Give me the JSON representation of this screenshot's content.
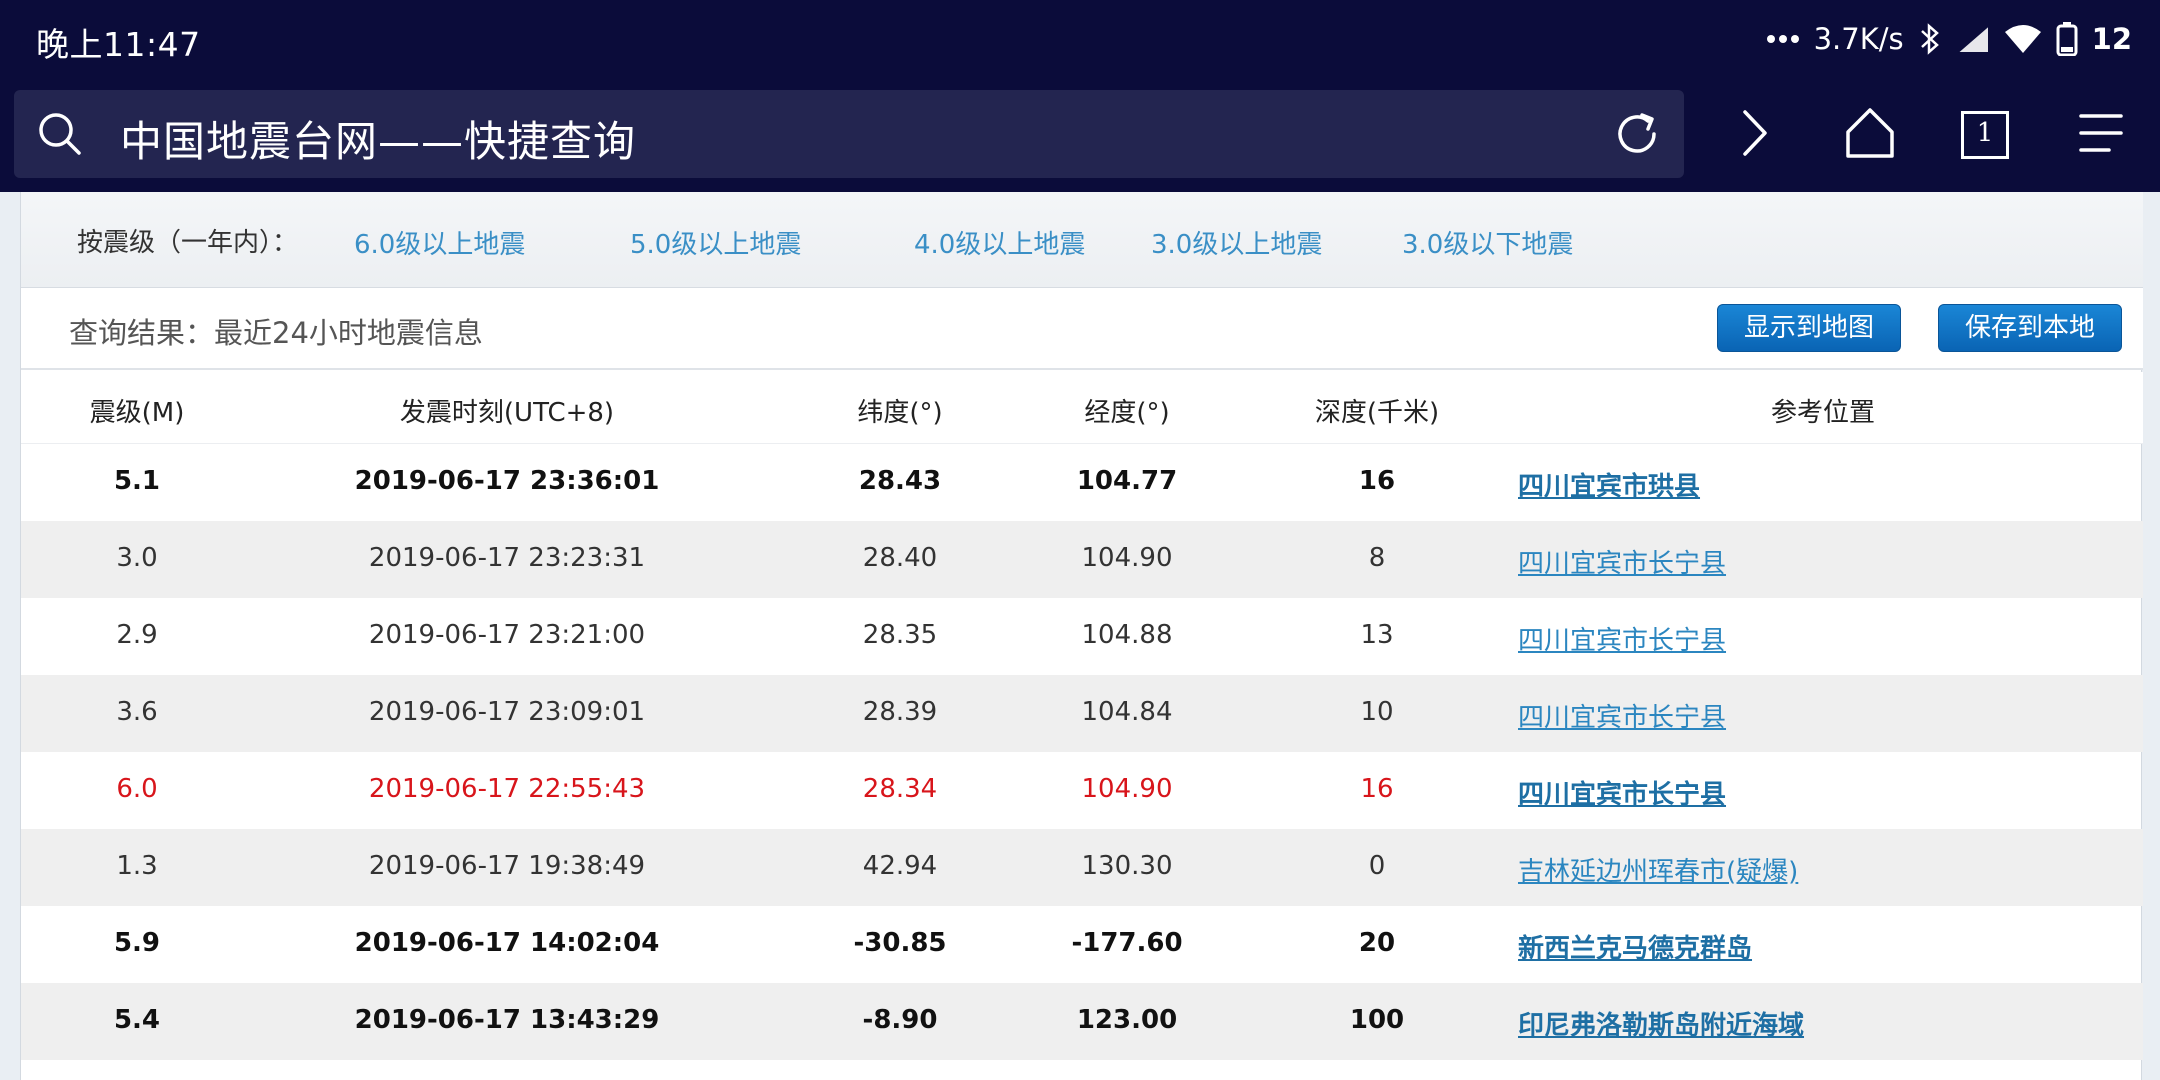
{
  "status_bar": {
    "time": "晚上11:47",
    "network_speed": "3.7K/s",
    "battery": "12",
    "icons": [
      "dots-icon",
      "bluetooth-icon",
      "cellular-signal-icon",
      "wifi-icon",
      "battery-icon"
    ]
  },
  "browser": {
    "page_title": "中国地震台网——快捷查询",
    "tab_count": "1",
    "colors": {
      "toolbar_bg": "#0b0c3a",
      "address_bg": "#232550"
    }
  },
  "filters": {
    "label": "按震级（一年内）：",
    "links": [
      "6.0级以上地震",
      "5.0级以上地震",
      "4.0级以上地震",
      "3.0级以上地震",
      "3.0级以下地震"
    ]
  },
  "result": {
    "title": "查询结果：最近24小时地震信息",
    "show_map_label": "显示到地图",
    "save_local_label": "保存到本地"
  },
  "table": {
    "headers": [
      "震级(M)",
      "发震时刻(UTC+8)",
      "纬度(°)",
      "经度(°)",
      "深度(千米)",
      "参考位置"
    ],
    "rows": [
      {
        "mag": "5.1",
        "time": "2019-06-17 23:36:01",
        "lat": "28.43",
        "lon": "104.77",
        "depth": "16",
        "loc": "四川宜宾市珙县",
        "style": "bold"
      },
      {
        "mag": "3.0",
        "time": "2019-06-17 23:23:31",
        "lat": "28.40",
        "lon": "104.90",
        "depth": "8",
        "loc": "四川宜宾市长宁县",
        "style": "normal"
      },
      {
        "mag": "2.9",
        "time": "2019-06-17 23:21:00",
        "lat": "28.35",
        "lon": "104.88",
        "depth": "13",
        "loc": "四川宜宾市长宁县",
        "style": "normal"
      },
      {
        "mag": "3.6",
        "time": "2019-06-17 23:09:01",
        "lat": "28.39",
        "lon": "104.84",
        "depth": "10",
        "loc": "四川宜宾市长宁县",
        "style": "normal"
      },
      {
        "mag": "6.0",
        "time": "2019-06-17 22:55:43",
        "lat": "28.34",
        "lon": "104.90",
        "depth": "16",
        "loc": "四川宜宾市长宁县",
        "style": "red"
      },
      {
        "mag": "1.3",
        "time": "2019-06-17 19:38:49",
        "lat": "42.94",
        "lon": "130.30",
        "depth": "0",
        "loc": "吉林延边州珲春市(疑爆)",
        "style": "normal"
      },
      {
        "mag": "5.9",
        "time": "2019-06-17 14:02:04",
        "lat": "-30.85",
        "lon": "-177.60",
        "depth": "20",
        "loc": "新西兰克马德克群岛",
        "style": "bold"
      },
      {
        "mag": "5.4",
        "time": "2019-06-17 13:43:29",
        "lat": "-8.90",
        "lon": "123.00",
        "depth": "100",
        "loc": "印尼弗洛勒斯岛附近海域",
        "style": "bold"
      }
    ],
    "colors": {
      "link": "#2b86c0",
      "highlight": "#d8151b",
      "alt_row": "#efefef"
    }
  }
}
